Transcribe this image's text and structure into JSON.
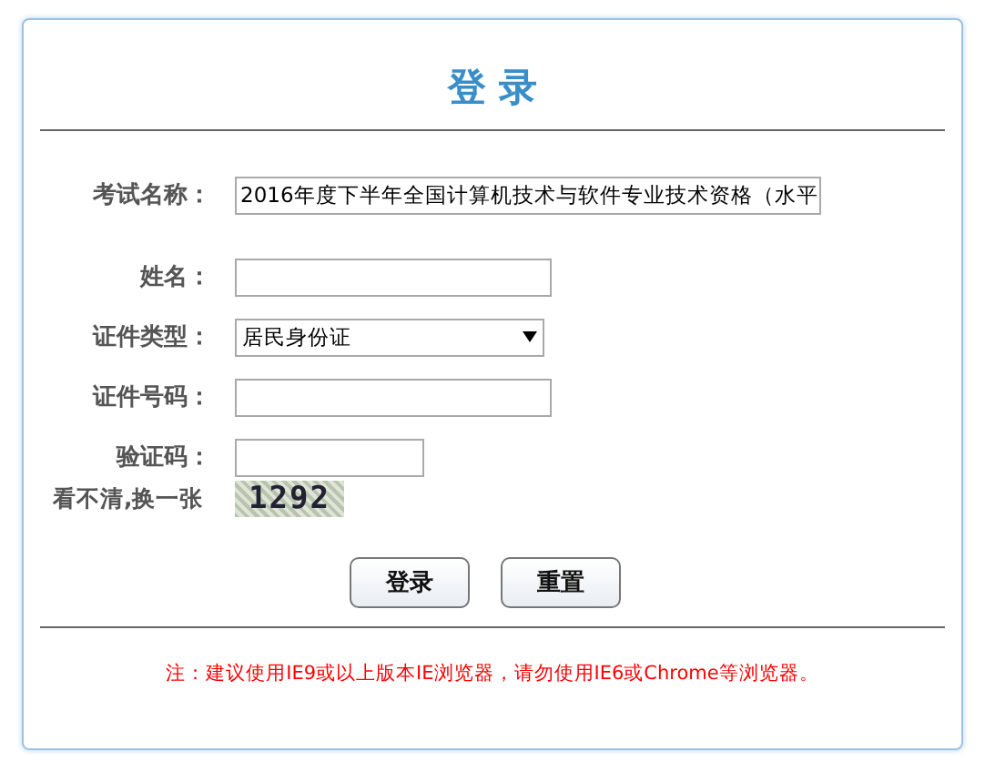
{
  "title": "登 录",
  "fields": [
    {
      "kind": "text",
      "label": "考试名称：",
      "value": "2016年度下半年全国计算机技术与软件专业技术资格（水平"
    },
    {
      "kind": "text",
      "label": "姓名："
    },
    {
      "kind": "select",
      "label": "证件类型：",
      "value": "居民身份证"
    },
    {
      "kind": "text",
      "label": "证件号码："
    },
    {
      "kind": "captcha",
      "label": "验证码："
    }
  ],
  "captcha": {
    "refresh_link": "看不清,换一张",
    "code": "1292"
  },
  "buttons": [
    "登录",
    "重置"
  ],
  "notice": "注：建议使用IE9或以上版本IE浏览器，请勿使用IE6或Chrome等浏览器。"
}
